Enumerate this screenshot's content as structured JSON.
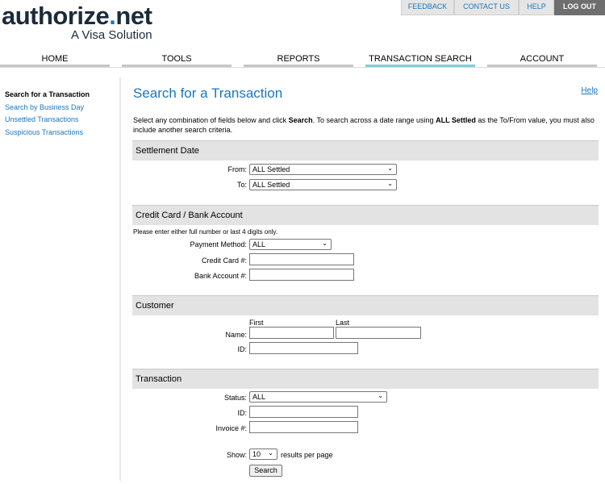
{
  "logo": {
    "main_prefix": "authorize",
    "main_dot": ".",
    "main_suffix": "net",
    "sub": "A Visa Solution"
  },
  "utility_nav": [
    "FEEDBACK",
    "CONTACT US",
    "HELP",
    "LOG OUT"
  ],
  "main_nav": [
    "HOME",
    "TOOLS",
    "REPORTS",
    "TRANSACTION SEARCH",
    "ACCOUNT"
  ],
  "sidebar": [
    "Search for a Transaction",
    "Search by Business Day",
    "Unsettled Transactions",
    "Suspicious Transactions"
  ],
  "page": {
    "title": "Search for a Transaction",
    "help": "Help",
    "intro": [
      "Select any combination of fields below and click ",
      "Search",
      ". To search across a date range using ",
      "ALL Settled",
      " as the To/From value, you must also include another search criteria."
    ]
  },
  "settlement": {
    "heading": "Settlement Date",
    "from_label": "From:",
    "from_value": "ALL Settled",
    "to_label": "To:",
    "to_value": "ALL Settled"
  },
  "card": {
    "heading": "Credit Card / Bank Account",
    "note": "Please enter either full number or last 4 digits only.",
    "payment_label": "Payment Method:",
    "payment_value": "ALL",
    "cc_label": "Credit Card #:",
    "bank_label": "Bank Account #:"
  },
  "customer": {
    "heading": "Customer",
    "first": "First",
    "last": "Last",
    "name_label": "Name:",
    "id_label": "ID:"
  },
  "transaction": {
    "heading": "Transaction",
    "status_label": "Status:",
    "status_value": "ALL",
    "id_label": "ID:",
    "invoice_label": "Invoice #:"
  },
  "results": {
    "show_label": "Show:",
    "show_value": "10",
    "suffix": "results per page",
    "search_button": "Search"
  },
  "colors": {
    "brand_blue": "#1c75bc",
    "active_tab": "#7fd0d8",
    "section_bg": "#e3e3e3",
    "logout_bg": "#6e6e6e"
  }
}
